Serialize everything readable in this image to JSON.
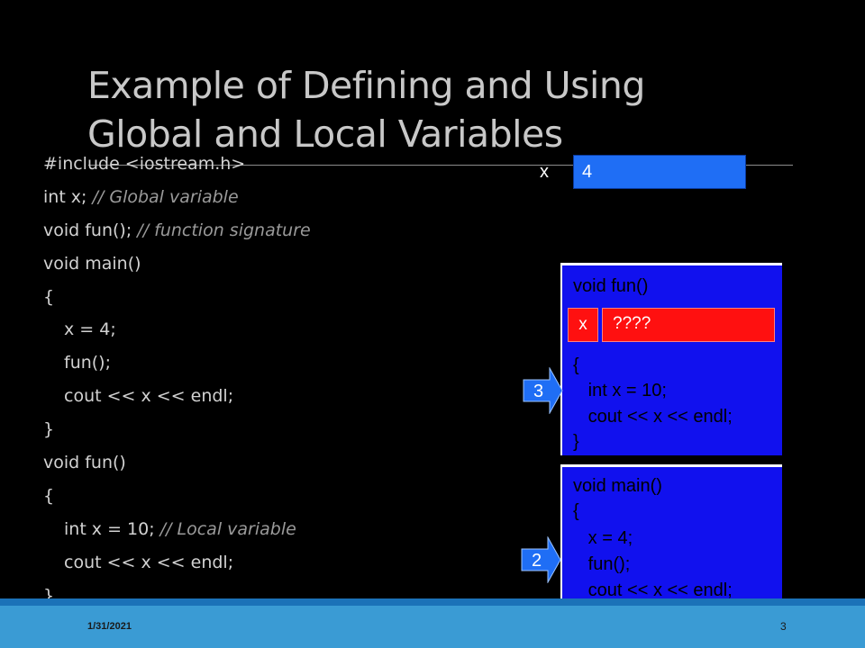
{
  "slide": {
    "title_line1": "Example of Defining and Using",
    "title_line2": "Global and Local Variables",
    "date": "1/31/2021",
    "page_number": "3"
  },
  "code": [
    {
      "code": "#include <iostream.h>",
      "comment": "",
      "indent": false
    },
    {
      "code": "int x; ",
      "comment": "// Global variable",
      "indent": false
    },
    {
      "code": "void fun(); ",
      "comment": "// function signature",
      "indent": false
    },
    {
      "code": "void main()",
      "comment": "",
      "indent": false
    },
    {
      "code": "{",
      "comment": "",
      "indent": false
    },
    {
      "code": "x = 4;",
      "comment": "",
      "indent": true
    },
    {
      "code": "fun();",
      "comment": "",
      "indent": true
    },
    {
      "code": "cout << x << endl;",
      "comment": "",
      "indent": true
    },
    {
      "code": "}",
      "comment": "",
      "indent": false
    },
    {
      "code": "void fun()",
      "comment": "",
      "indent": false
    },
    {
      "code": "{",
      "comment": "",
      "indent": false
    },
    {
      "code": "int x = 10; ",
      "comment": "// Local variable",
      "indent": true
    },
    {
      "code": "cout << x << endl;",
      "comment": "",
      "indent": true
    },
    {
      "code": "}",
      "comment": "",
      "indent": false
    }
  ],
  "global_var": {
    "name": "x",
    "value": "4"
  },
  "fun_frame": {
    "header": "void fun()",
    "local_var": {
      "name": "x",
      "value": "????"
    },
    "body": [
      "{",
      "   int x = 10;",
      "   cout << x << endl;",
      "}"
    ]
  },
  "main_frame": {
    "lines": [
      "void main()",
      "{",
      "   x = 4;",
      "   fun();",
      "   cout << x << endl;",
      "}"
    ]
  },
  "pointers": {
    "fun_step": "3",
    "main_step": "2"
  },
  "colors": {
    "background": "#000000",
    "frame_blue": "#1111ee",
    "global_box": "#1f6ef5",
    "local_box": "#ff1010",
    "arrow": "#1f6ef5",
    "footer": "#3a9bd4"
  }
}
